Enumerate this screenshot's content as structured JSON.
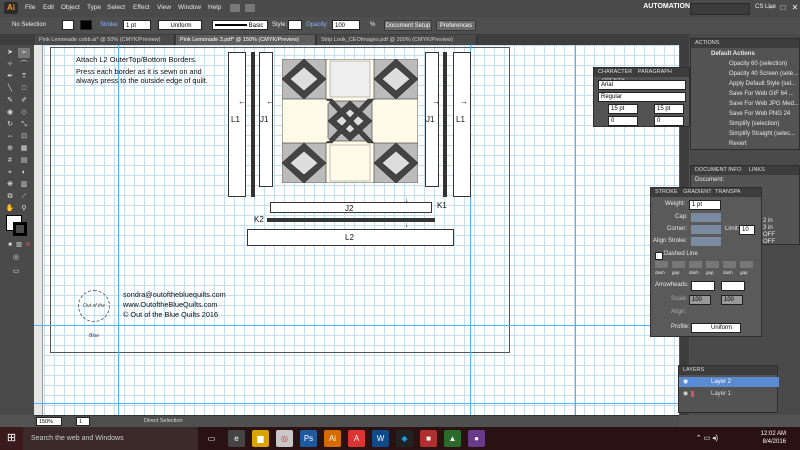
{
  "menubar": {
    "app_logo": "Ai",
    "items": [
      "File",
      "Edit",
      "Object",
      "Type",
      "Select",
      "Effect",
      "View",
      "Window",
      "Help"
    ],
    "workspace": "AUTOMATION",
    "cc_live": "CS Live"
  },
  "controlbar": {
    "selection": "No Selection",
    "stroke_label": "Stroke:",
    "stroke_weight": "1 pt",
    "profile": "Uniform",
    "brush": "Basic",
    "style_label": "Style:",
    "opacity_label": "Opacity:",
    "opacity_value": "100",
    "opacity_unit": "%",
    "document_setup": "Document Setup",
    "preferences": "Preferences"
  },
  "tabs": [
    {
      "label": "Pink Lemonade cobb.ai* @ 50% (CMYK/Preview)",
      "active": false
    },
    {
      "label": "Pink Lemonade 3.pdf* @ 150% (CMYK/Preview)",
      "active": true
    },
    {
      "label": "Strip Look_CEOImages.pdf @ 200% (CMYK/Preview)",
      "active": false
    }
  ],
  "document": {
    "heading": "Attach L2 OuterTop/Bottom Borders.",
    "instruction_line1": "Press each border as it is sewn on and",
    "instruction_line2": "always press to the outside edge of quilt.",
    "labels": {
      "l1_left": "L1",
      "j1_left": "J1",
      "j1_right": "J1",
      "l1_right": "L1",
      "j2": "J2",
      "k1": "K1",
      "k2": "K2",
      "l2": "L2"
    },
    "email": "sondra@outofthebluequilts.com",
    "website": "www.OutoftheBlueQuilts.com",
    "copyright": "© Out of the Blue Quilts 2016",
    "logo_text": "Out of the Blue"
  },
  "statusbar": {
    "zoom": "150%",
    "page": "1",
    "tool": "Direct Selection"
  },
  "actions_panel": {
    "title": "ACTIONS",
    "set": "Default Actions",
    "items": [
      "Opacity 60 (selection)",
      "Opacity 40 Screen (sele...",
      "Apply Default Style (sel...",
      "Save For Web GIF 64 ...",
      "Save For Web JPG Med...",
      "Save For Web PNG 24",
      "Simplify (selection)",
      "Simplify Straight (selec...",
      "Revert"
    ]
  },
  "character_panel": {
    "tab1": "CHARACTER",
    "tab2": "PARAGRAPH",
    "tab3": "OPENTY",
    "font": "Arial",
    "style": "Regular",
    "size": "15 pt",
    "leading": "15 pt",
    "kerning": "0",
    "tracking": "0"
  },
  "docinfo_panel": {
    "tab1": "DOCUMENT INFO",
    "tab2": "LINKS",
    "text1": "Document:",
    "side": [
      "2 in",
      "3 in",
      "OFF",
      "OFF"
    ]
  },
  "stroke_panel": {
    "tab1": "STROKE",
    "tab2": "GRADIENT",
    "tab3": "TRANSPA",
    "weight_label": "Weight:",
    "weight": "1 pt",
    "cap_label": "Cap:",
    "corner_label": "Corner:",
    "limit_label": "Limit:",
    "limit": "10",
    "align_label": "Align Stroke:",
    "dashed_label": "Dashed Line",
    "dash_labels": [
      "dash",
      "gap",
      "dash",
      "gap",
      "dash",
      "gap"
    ],
    "arrowheads_label": "Arrowheads:",
    "scale_label": "Scale:",
    "scale1": "100",
    "scale2": "100",
    "align2_label": "Align:",
    "profile_label": "Profile:",
    "profile": "Uniform"
  },
  "layers_panel": {
    "title": "LAYERS",
    "layers": [
      {
        "name": "Layer 2",
        "color": "#4f8cff"
      },
      {
        "name": "Layer 1",
        "color": "#e05050"
      }
    ]
  },
  "taskbar": {
    "start": "⊞",
    "search_placeholder": "Search the web and Windows",
    "time": "12:02 AM",
    "date": "8/4/2016"
  }
}
